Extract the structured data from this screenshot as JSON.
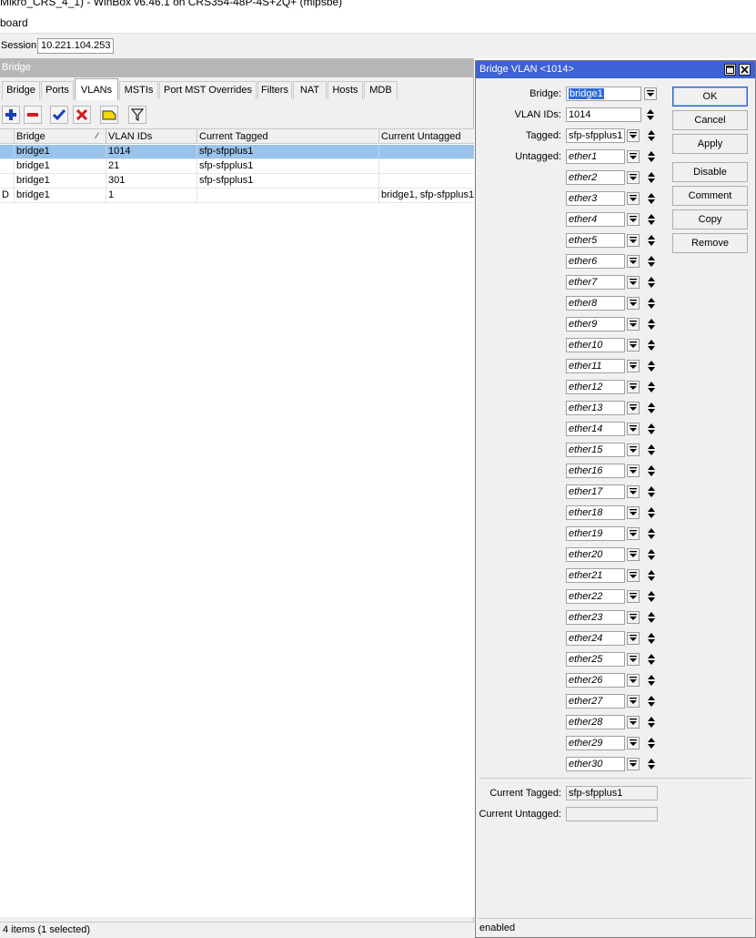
{
  "window": {
    "title": "Mikro_CRS_4_1) - WinBox v6.46.1 on CRS354-48P-4S+2Q+ (mipsbe)",
    "menu_label": "board",
    "session_label": "Session:",
    "session_value": "10.221.104.253"
  },
  "bridge": {
    "title": "Bridge",
    "tabs": [
      {
        "label": "Bridge"
      },
      {
        "label": "Ports"
      },
      {
        "label": "VLANs"
      },
      {
        "label": "MSTIs"
      },
      {
        "label": "Port MST Overrides"
      },
      {
        "label": "Filters"
      },
      {
        "label": "NAT"
      },
      {
        "label": "Hosts"
      },
      {
        "label": "MDB"
      }
    ],
    "toolbar_icons": [
      "add-icon",
      "remove-icon",
      "enable-check-icon",
      "disable-x-icon",
      "comment-note-icon",
      "filter-funnel-icon"
    ],
    "columns": [
      "Bridge",
      "VLAN IDs",
      "Current Tagged",
      "Current Untagged"
    ],
    "rows": [
      {
        "flag": "",
        "bridge": "bridge1",
        "vlan_ids": "1014",
        "current_tagged": "sfp-sfpplus1",
        "current_untagged": ""
      },
      {
        "flag": "",
        "bridge": "bridge1",
        "vlan_ids": "21",
        "current_tagged": "sfp-sfpplus1",
        "current_untagged": ""
      },
      {
        "flag": "",
        "bridge": "bridge1",
        "vlan_ids": "301",
        "current_tagged": "sfp-sfpplus1",
        "current_untagged": ""
      },
      {
        "flag": "D",
        "bridge": "bridge1",
        "vlan_ids": "1",
        "current_tagged": "",
        "current_untagged": "bridge1, sfp-sfpplus1"
      }
    ],
    "status": "4 items (1 selected)"
  },
  "dialog": {
    "title": "Bridge VLAN <1014>",
    "bridge_label": "Bridge:",
    "bridge_value": "bridge1",
    "vlan_ids_label": "VLAN IDs:",
    "vlan_ids_value": "1014",
    "tagged_label": "Tagged:",
    "tagged_value": "sfp-sfpplus1",
    "untagged_label": "Untagged:",
    "untagged": [
      "ether1",
      "ether2",
      "ether3",
      "ether4",
      "ether5",
      "ether6",
      "ether7",
      "ether8",
      "ether9",
      "ether10",
      "ether11",
      "ether12",
      "ether13",
      "ether14",
      "ether15",
      "ether16",
      "ether17",
      "ether18",
      "ether19",
      "ether20",
      "ether21",
      "ether22",
      "ether23",
      "ether24",
      "ether25",
      "ether26",
      "ether27",
      "ether28",
      "ether29",
      "ether30"
    ],
    "current_tagged_label": "Current Tagged:",
    "current_tagged_value": "sfp-sfpplus1",
    "current_untagged_label": "Current Untagged:",
    "current_untagged_value": "",
    "buttons": {
      "ok": "OK",
      "cancel": "Cancel",
      "apply": "Apply",
      "disable": "Disable",
      "comment": "Comment",
      "copy": "Copy",
      "remove": "Remove"
    },
    "status": "enabled"
  },
  "colors": {
    "dialog_title_bg": "#3f61d6",
    "selected_row": "#99c3ea",
    "add_icon": "#1a3fb8",
    "remove_icon": "#d01c1c",
    "check_icon": "#1a3fb8",
    "x_icon": "#d01c1c",
    "note_icon": "#f5d800"
  }
}
